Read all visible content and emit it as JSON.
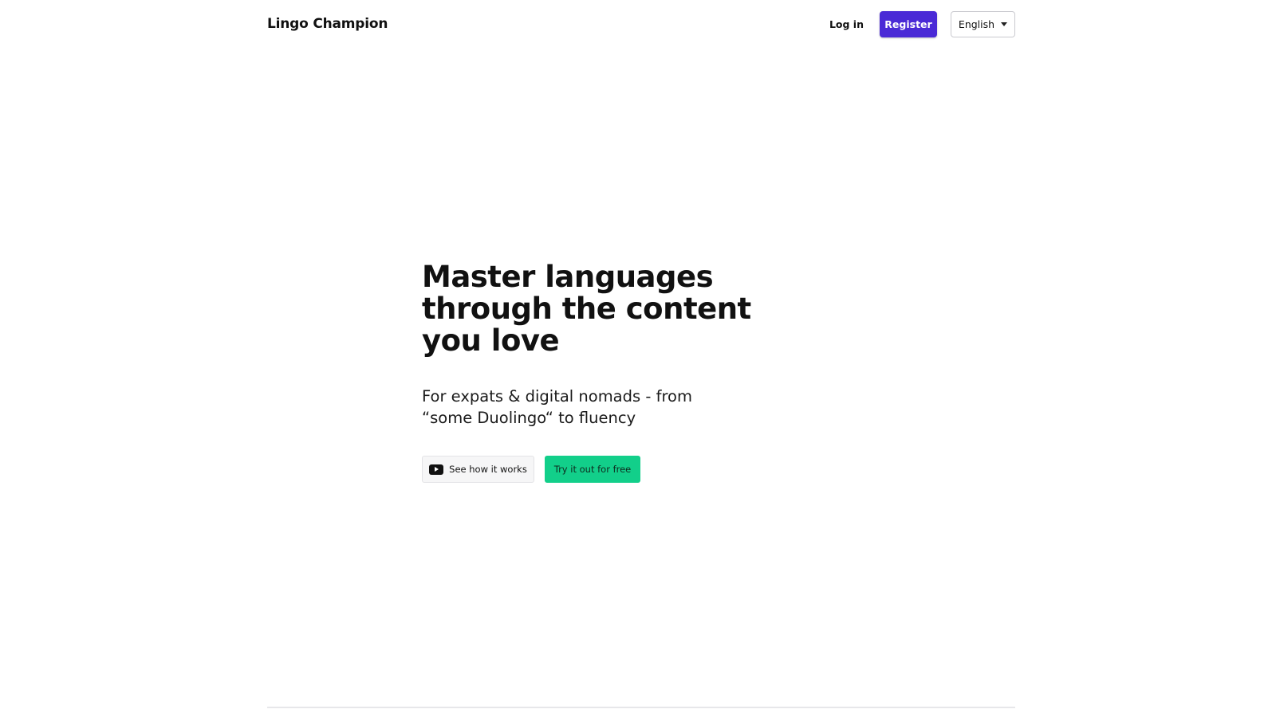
{
  "header": {
    "brand": "Lingo Champion",
    "login_label": "Log in",
    "register_label": "Register",
    "language_selected": "English"
  },
  "hero": {
    "title": "Master languages through the content you love",
    "subtitle": "For expats & digital nomads - from “some Duolingo“ to fluency",
    "video_button_label": "See how it works",
    "try_button_label": "Try it out for free"
  },
  "icons": {
    "video": "youtube-play-icon",
    "dropdown": "chevron-down-icon"
  },
  "colors": {
    "register_bg": "#4a2ad6",
    "try_bg": "#12cf8a"
  }
}
